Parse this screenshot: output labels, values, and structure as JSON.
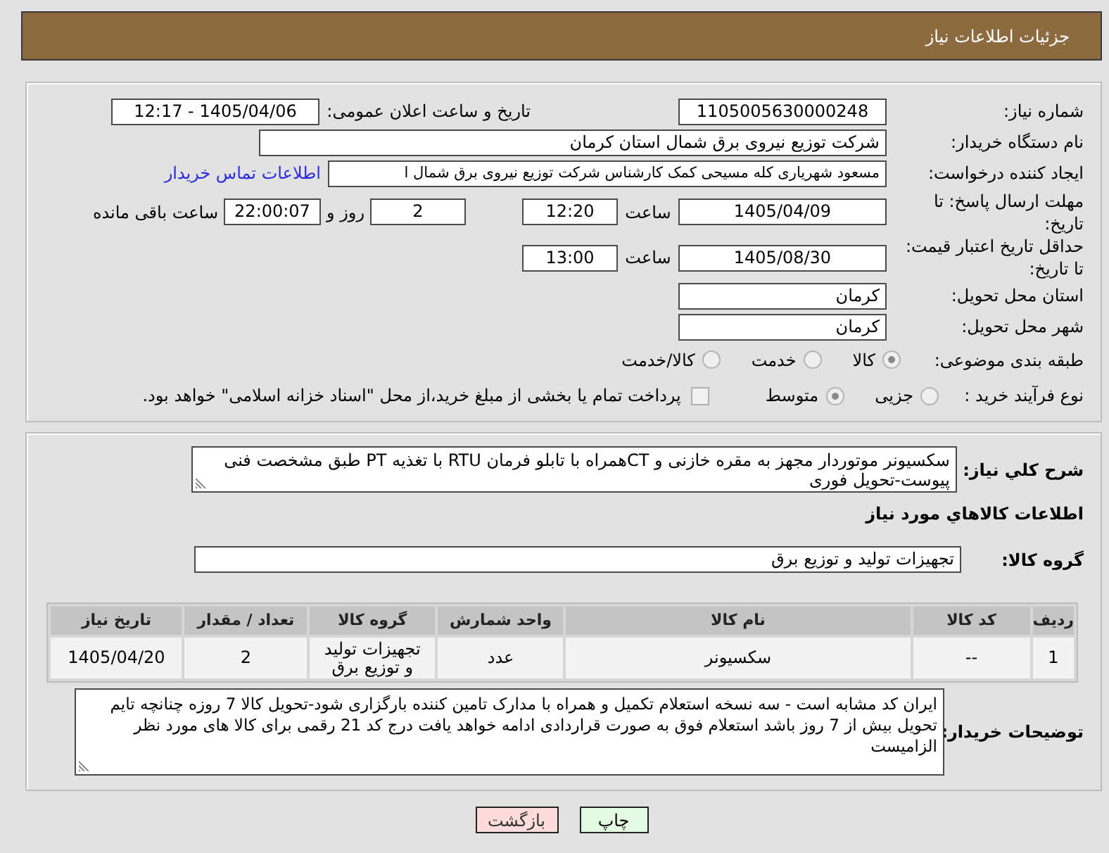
{
  "header": {
    "title": "جزئیات اطلاعات نیاز"
  },
  "details": {
    "need_number": {
      "label": "شماره نیاز:",
      "value": "1105005630000248"
    },
    "announcement": {
      "label": "تاریخ و ساعت اعلان عمومی:",
      "value": "1405/04/06 - 12:17"
    },
    "buyer_org": {
      "label": "نام دستگاه خریدار:",
      "value": "شرکت توزیع نیروی برق شمال استان کرمان"
    },
    "requester": {
      "label": "ایجاد کننده درخواست:",
      "value": "مسعود شهریاری کله مسیحی کمک کارشناس شرکت توزیع نیروی برق شمال ا",
      "contact_link": "اطلاعات تماس خریدار"
    },
    "response_deadline": {
      "label": "مهلت ارسال پاسخ: تا تاریخ:",
      "date": "1405/04/09",
      "time_label": "ساعت",
      "time": "12:20",
      "days": "2",
      "days_label": "روز و",
      "remaining": "22:00:07",
      "remaining_label": "ساعت باقی مانده"
    },
    "price_validity": {
      "label": "حداقل تاریخ اعتبار قیمت: تا تاریخ:",
      "date": "1405/08/30",
      "time_label": "ساعت",
      "time": "13:00"
    },
    "delivery_province": {
      "label": "استان محل تحویل:",
      "value": "کرمان"
    },
    "delivery_city": {
      "label": "شهر محل تحویل:",
      "value": "کرمان"
    },
    "category": {
      "label": "طبقه بندی موضوعی:",
      "options": [
        {
          "label": "کالا",
          "selected": true
        },
        {
          "label": "خدمت",
          "selected": false
        },
        {
          "label": "کالا/خدمت",
          "selected": false
        }
      ]
    },
    "purchase_process": {
      "label": "نوع فرآیند خرید :",
      "options": [
        {
          "label": "جزیی",
          "selected": false
        },
        {
          "label": "متوسط",
          "selected": true
        }
      ],
      "treasury_payment": {
        "label": "پرداخت تمام یا بخشی از مبلغ خرید،از محل \"اسناد خزانه اسلامی\" خواهد بود.",
        "checked": false
      }
    }
  },
  "needs": {
    "description": {
      "label": "شرح کلي نیاز:",
      "value": "سکسیونر موتوردار مجهز به مقره خازنی و CTهمراه با تابلو فرمان RTU با تغذیه PT طبق مشخصت فنی پیوست-تحویل فوری"
    },
    "section_title": "اطلاعات كالاهاي مورد نياز",
    "goods_group": {
      "label": "گروه کالا:",
      "value": "تجهیزات تولید و توزیع برق"
    },
    "table": {
      "columns": [
        "ردیف",
        "کد کالا",
        "نام کالا",
        "واحد شمارش",
        "گروه کالا",
        "تعداد / مقدار",
        "تاریخ نیاز"
      ],
      "rows": [
        [
          "1",
          "--",
          "سکسیونر",
          "عدد",
          "تجهیزات تولید و توزیع برق",
          "2",
          "1405/04/20"
        ]
      ]
    },
    "buyer_notes": {
      "label": "توضیحات خریدار:",
      "value": "ایران کد مشابه است - سه نسخه استعلام تکمیل و همراه با مدارک تامین کننده بارگزاری شود-تحویل کالا 7 روزه چنانچه تایم تحویل بیش از 7 روز باشد استعلام فوق به صورت قراردادی ادامه خواهد یافت  درج کد 21 رقمی برای کالا های مورد نظر الزامیست"
    }
  },
  "buttons": [
    {
      "kind": "print",
      "label": "چاپ"
    },
    {
      "kind": "back",
      "label": "بازگشت"
    }
  ]
}
